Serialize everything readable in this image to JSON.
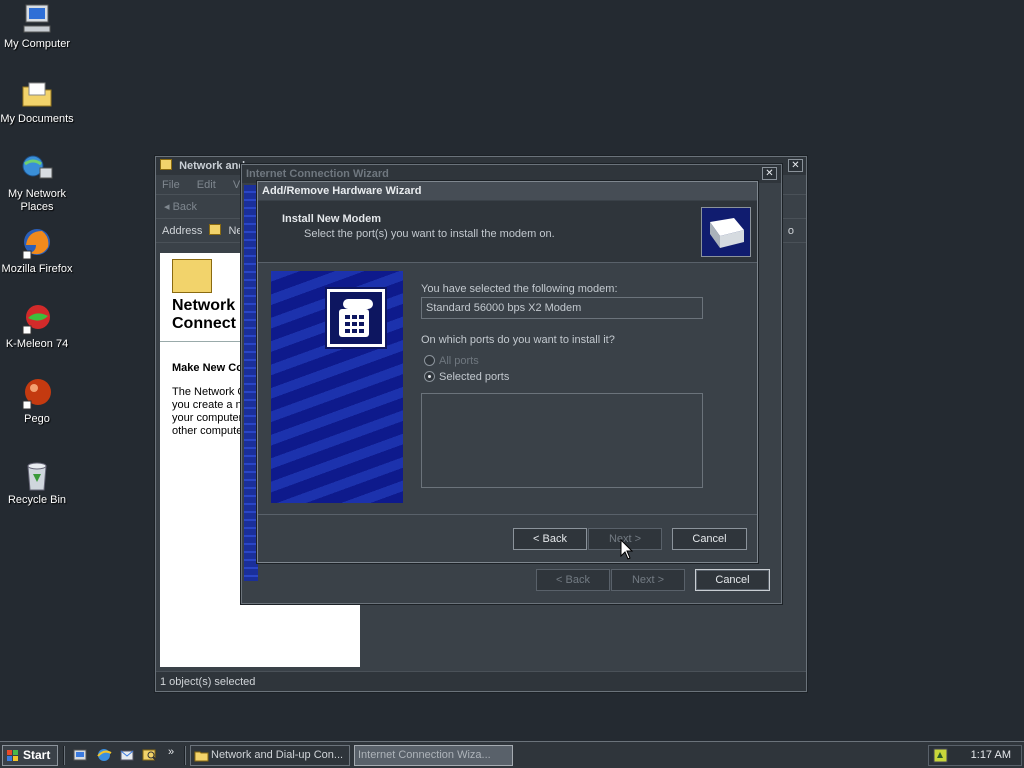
{
  "desktop": {
    "icons": [
      {
        "label": "My Computer"
      },
      {
        "label": "My Documents"
      },
      {
        "label_line1": "My Network",
        "label_line2": "Places"
      },
      {
        "label": "Mozilla Firefox"
      },
      {
        "label": "K-Meleon 74"
      },
      {
        "label": "Pego"
      },
      {
        "label": "Recycle Bin"
      }
    ]
  },
  "network_window": {
    "title": "Network and",
    "menu": [
      "File",
      "Edit",
      "V"
    ],
    "toolbar_back": "Back",
    "address_label": "Address",
    "address_value": "Ne",
    "go_label": "o",
    "heading_line1": "Network",
    "heading_line2": "Connect",
    "subheading": "Make New Co",
    "para_lines": [
      "The Network C",
      "you create a n",
      "your computer",
      "other compute"
    ],
    "status": "1 object(s) selected"
  },
  "icw_window": {
    "title": "Internet Connection Wizard",
    "back_label": "< Back",
    "next_label": "Next >",
    "cancel_label": "Cancel"
  },
  "hw_wizard": {
    "title": "Add/Remove Hardware Wizard",
    "header_title": "Install New Modem",
    "header_subtitle": "Select the port(s) you want to install the modem on.",
    "selected_label": "You have selected the following modem:",
    "modem_value": "Standard 56000 bps X2 Modem",
    "ports_question": "On which ports do you want to install it?",
    "radio_all": "All ports",
    "radio_selected": "Selected ports",
    "back_label": "< Back",
    "next_label": "Next >",
    "cancel_label": "Cancel"
  },
  "taskbar": {
    "start_label": "Start",
    "tasks": [
      {
        "label": "Network and Dial-up Con..."
      },
      {
        "label": "Internet Connection Wiza..."
      }
    ],
    "clock": "1:17 AM"
  }
}
